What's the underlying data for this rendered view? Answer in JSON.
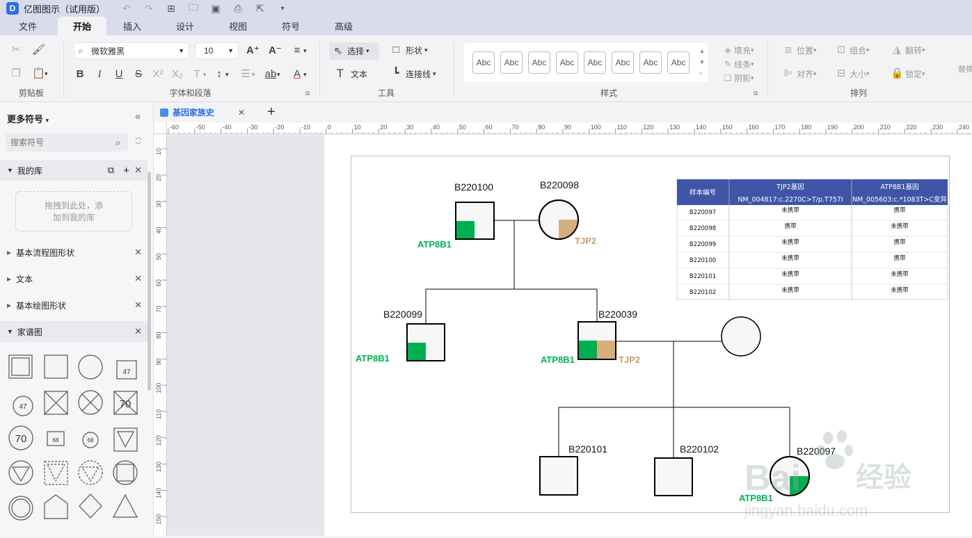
{
  "app": {
    "logo": "D",
    "title": "亿图图示（试用版）"
  },
  "quick_access": [
    "undo-icon",
    "redo-icon",
    "new-icon",
    "open-icon",
    "save-icon",
    "print-icon",
    "export-icon",
    "more-icon"
  ],
  "menu": {
    "tabs": [
      "文件",
      "开始",
      "插入",
      "设计",
      "视图",
      "符号",
      "高级"
    ],
    "active": "开始"
  },
  "ribbon": {
    "clipboard": {
      "label": "剪贴板"
    },
    "font": {
      "label": "字体和段落",
      "family": "微软雅黑",
      "size": "10"
    },
    "tools": {
      "label": "工具",
      "select": "选择",
      "shape": "形状",
      "text": "文本",
      "connector": "连接线"
    },
    "styles": {
      "label": "样式",
      "swatch": "Abc",
      "fill": "填充",
      "line": "线条",
      "shadow": "阴影"
    },
    "arrange": {
      "label": "排列",
      "position": "位置",
      "group": "组合",
      "flip": "翻转",
      "align": "对齐",
      "size": "大小",
      "lock": "锁定",
      "replace": "替换"
    }
  },
  "sidebar": {
    "title": "更多符号",
    "search_placeholder": "搜索符号",
    "my_library": "我的库",
    "drop_hint_1": "拖拽到此处，添",
    "drop_hint_2": "加到我的库",
    "sections": [
      "基本流程图形状",
      "文本",
      "基本绘图形状",
      "家谱图"
    ],
    "shape_labels": {
      "s47": "47",
      "s70a": "70",
      "s70b": "70",
      "s68a": "68",
      "s68b": "68",
      "s47b": "47"
    }
  },
  "document": {
    "tab_title": "基因家族史"
  },
  "ruler": {
    "h_ticks": [
      "-60",
      "-50",
      "-40",
      "-30",
      "-20",
      "-10",
      "0",
      "10",
      "20",
      "30",
      "40",
      "50",
      "60",
      "70",
      "80",
      "90",
      "100",
      "110",
      "120",
      "130",
      "140",
      "150",
      "160",
      "170",
      "180",
      "190",
      "200",
      "210",
      "220",
      "230",
      "240"
    ],
    "v_ticks": [
      "10",
      "20",
      "30",
      "40",
      "50",
      "60",
      "70",
      "80",
      "90",
      "100",
      "110",
      "120",
      "130",
      "140",
      "150"
    ]
  },
  "pedigree": {
    "individuals": {
      "b220100": "B220100",
      "b220098": "B220098",
      "b220099": "B220099",
      "b220039": "B220039",
      "b220101": "B220101",
      "b220102": "B220102",
      "b220097": "B220097"
    },
    "gene_labels": {
      "atp8b1": "ATP8B1",
      "tjp2": "TJP2"
    },
    "colors": {
      "atp8b1": "#00b050",
      "tjp2": "#d6b07c",
      "table_header": "#3f55a7"
    }
  },
  "table": {
    "headers": [
      {
        "line1": "样本编号",
        "line2": ""
      },
      {
        "line1": "TJP2基因",
        "line2": "NM_004817:c.2270C>T/p.T757I"
      },
      {
        "line1": "ATP8B1基因",
        "line2": "NM_005603:c.*1083T>C变异"
      }
    ],
    "rows": [
      [
        "B220097",
        "未携带",
        "携带"
      ],
      [
        "B220098",
        "携带",
        "未携带"
      ],
      [
        "B220099",
        "未携带",
        "携带"
      ],
      [
        "B220100",
        "未携带",
        "携带"
      ],
      [
        "B220101",
        "未携带",
        "未携带"
      ],
      [
        "B220102",
        "未携带",
        "未携带"
      ]
    ]
  },
  "watermark": {
    "brand": "Bai",
    "brand2": "经验",
    "url": "jingyan.baidu.com"
  }
}
